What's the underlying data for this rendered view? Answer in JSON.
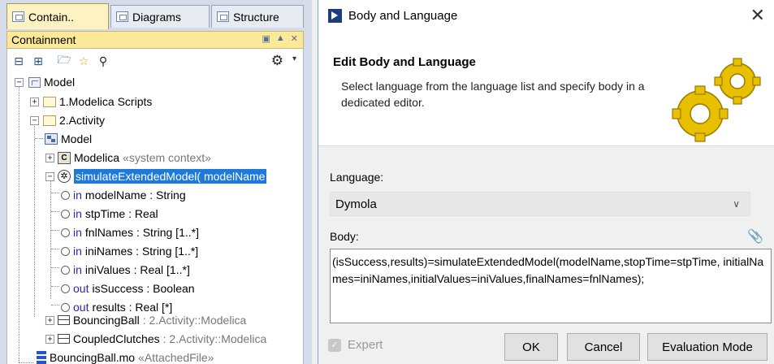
{
  "tabs": [
    {
      "label": "Contain..",
      "icon": "containment-tree-icon",
      "active": true
    },
    {
      "label": "Diagrams",
      "icon": "diagrams-icon",
      "active": false
    },
    {
      "label": "Structure",
      "icon": "structure-icon",
      "active": false
    }
  ],
  "panel": {
    "title": "Containment"
  },
  "tree": {
    "model": "Model",
    "scripts": "1.Modelica Scripts",
    "activity": "2.Activity",
    "model_diagram": "Model",
    "modelica": "Modelica",
    "modelica_stereo": "«system context»",
    "simulate": "simulateExtendedModel( modelName",
    "params": [
      {
        "kw": "in",
        "name": "modelName",
        "type": " : String"
      },
      {
        "kw": "in",
        "name": "stpTime",
        "type": " : Real"
      },
      {
        "kw": "in",
        "name": "fnlNames",
        "type": " : String [1..*]"
      },
      {
        "kw": "in",
        "name": "iniNames",
        "type": " : String [1..*]"
      },
      {
        "kw": "in",
        "name": "iniValues",
        "type": " : Real [1..*]"
      },
      {
        "kw": "out",
        "name": "isSuccess",
        "type": " : Boolean"
      },
      {
        "kw": "out",
        "name": "results",
        "type": " : Real [*]"
      }
    ],
    "bouncing": "BouncingBall",
    "bouncing_type": " : 2.Activity::Modelica",
    "coupled": "CoupledClutches",
    "coupled_type": " : 2.Activity::Modelica",
    "file": "BouncingBall.mo",
    "file_stereo": "«AttachedFile»"
  },
  "dialog": {
    "title": "Body and Language",
    "heading": "Edit Body and Language",
    "description": "Select language from the language list and specify body in a dedicated editor.",
    "language_label": "Language:",
    "language_value": "Dymola",
    "body_label": "Body:",
    "body_text": "(isSuccess,results)=simulateExtendedModel(modelName,stopTime=stpTime, initialNames=iniNames,initialValues=iniValues,finalNames=fnlNames);",
    "expert_label": "Expert",
    "ok_label": "OK",
    "cancel_label": "Cancel",
    "eval_label": "Evaluation Mode"
  },
  "colors": {
    "selection": "#1e7ad8",
    "panel_header": "#fde99a",
    "gear": "#e8c000"
  }
}
